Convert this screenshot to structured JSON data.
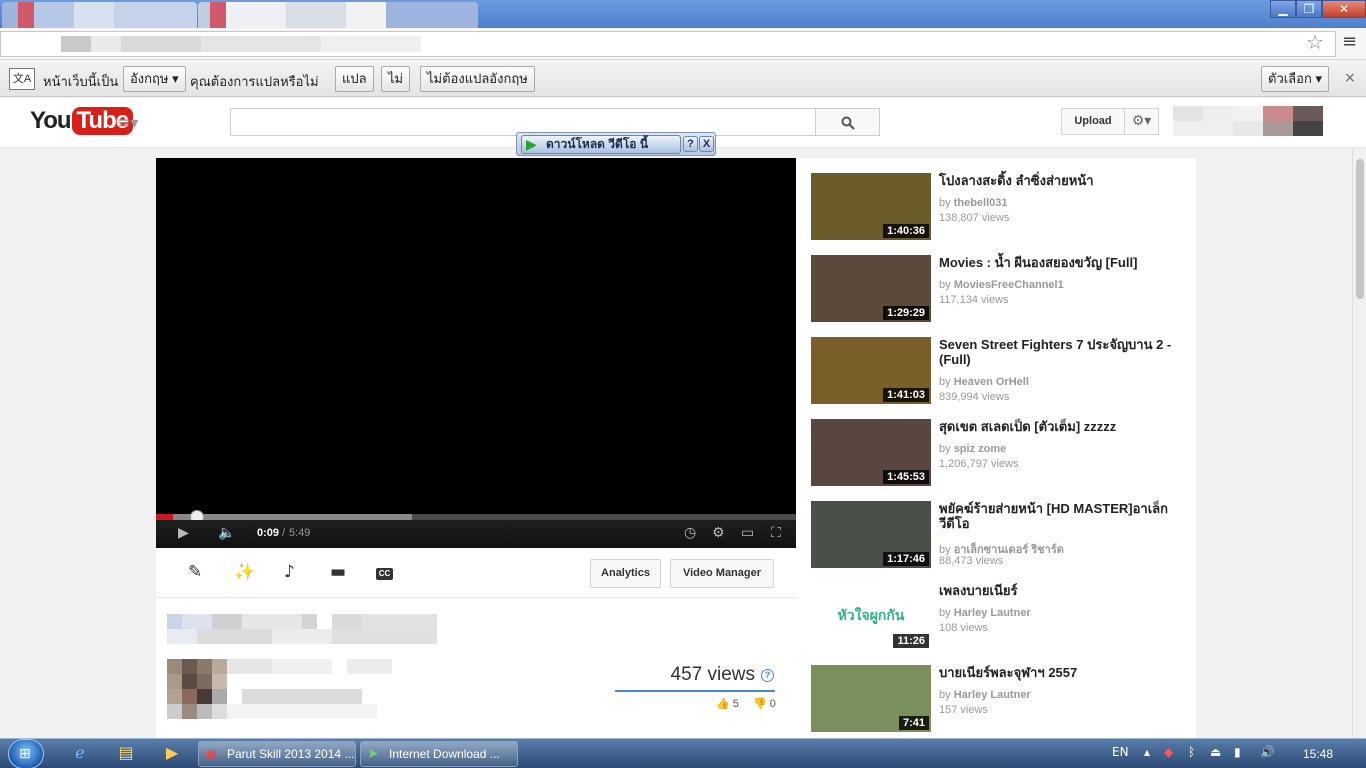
{
  "browser": {
    "star_icon": "star-icon",
    "menu_icon": "menu-icon"
  },
  "translate_bar": {
    "prefix": "หน้าเว็บนี้เป็น",
    "language": "อังกฤษ ▾",
    "question": "คุณต้องการแปลหรือไม่",
    "translate": "แปล",
    "no": "ไม่",
    "never": "ไม่ต้องแปลอังกฤษ",
    "options": "ตัวเลือก ▾",
    "close": "×"
  },
  "youtube_header": {
    "logo_you": "You",
    "logo_tube": "Tube",
    "upload": "Upload",
    "search_placeholder": ""
  },
  "idm": {
    "download_label": "ดาวน์โหลด วีดีโอ นี้",
    "help": "?",
    "close": "X"
  },
  "player": {
    "time_current": "0:09",
    "time_separator": "/",
    "time_total": "5:49",
    "played_fraction": 0.026,
    "loaded_fraction": 0.4
  },
  "actions": {
    "analytics": "Analytics",
    "video_manager": "Video Manager",
    "cc": "CC"
  },
  "stats": {
    "views": "457 views",
    "likes": "5",
    "dislikes": "0"
  },
  "related": [
    {
      "title": "โปงลางสะดิ้ง ลำซิ่งส่ายหน้า",
      "by": "by",
      "channel": "thebell031",
      "views": "138,807 views",
      "duration": "1:40:36",
      "color": "#6b5a2a"
    },
    {
      "title": "Movies : น้ำ ผีนองสยองขวัญ [Full]",
      "by": "by",
      "channel": "MoviesFreeChannel1",
      "views": "117,134 views",
      "duration": "1:29:29",
      "color": "#5b4a3a"
    },
    {
      "title": "Seven Street Fighters 7 ประจัญบาน 2 - (Full)",
      "by": "by",
      "channel": "Heaven OrHell",
      "views": "839,994 views",
      "duration": "1:41:03",
      "color": "#7a5f2a"
    },
    {
      "title": "สุดเขต สเลดเป็ด [ตัวเต็ม] zzzzz",
      "by": "by",
      "channel": "spiz zome",
      "views": "1,206,797 views",
      "duration": "1:45:53",
      "color": "#5a4640"
    },
    {
      "title": "พยัคฆ์ร้ายส่ายหน้า [HD MASTER]อาเล็ก วีดีโอ",
      "by": "by",
      "channel": "อาเล็กซานเดอร์ ริชาร์ด",
      "views": "88,473 views",
      "duration": "1:17:46",
      "color": "#4a4f4a"
    },
    {
      "title": "เพลงบายเนียร์",
      "by": "by",
      "channel": "Harley Lautner",
      "views": "108 views",
      "duration": "11:26",
      "color": "#ffffff",
      "thumb_text": "หัวใจผูกกัน"
    },
    {
      "title": "บายเนียร์พละจุฬาฯ 2557",
      "by": "by",
      "channel": "Harley Lautner",
      "views": "157 views",
      "duration": "7:41",
      "color": "#7a8f5a"
    }
  ],
  "taskbar": {
    "tasks": [
      {
        "label": "Parut Skill 2013 2014 ...",
        "icon": "chrome-icon"
      },
      {
        "label": "Internet Download ...",
        "icon": "idm-icon"
      }
    ],
    "language": "EN",
    "clock": "15:48"
  }
}
